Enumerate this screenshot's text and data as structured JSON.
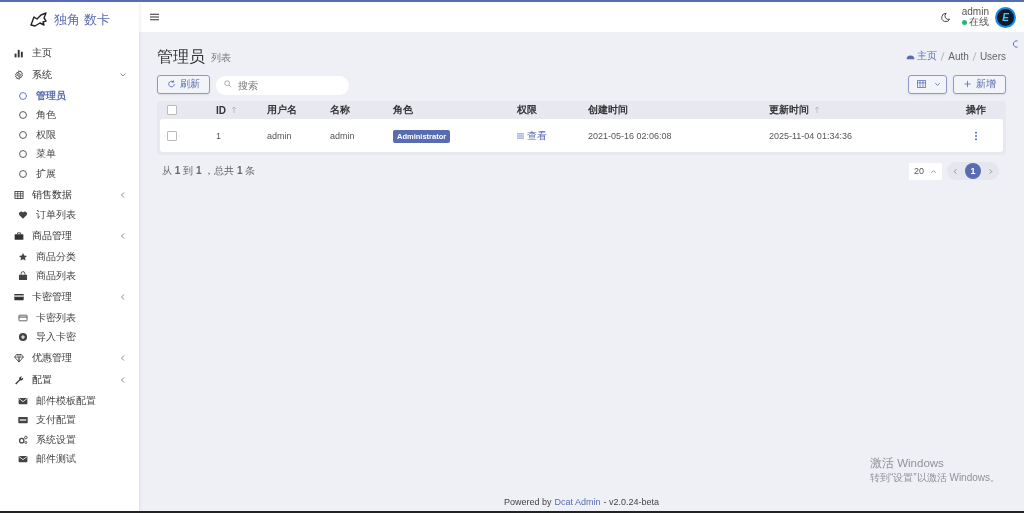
{
  "brand": {
    "name": "独角 数卡"
  },
  "sidebar": {
    "items": [
      {
        "label": "主页",
        "selected": false
      },
      {
        "label": "系统",
        "selected": false,
        "expanded": true,
        "children": [
          {
            "label": "管理员",
            "selected": true
          },
          {
            "label": "角色",
            "selected": false
          },
          {
            "label": "权限",
            "selected": false
          },
          {
            "label": "菜单",
            "selected": false
          },
          {
            "label": "扩展",
            "selected": false
          }
        ]
      },
      {
        "label": "销售数据",
        "selected": false,
        "expanded": false,
        "children": [
          {
            "label": "订单列表",
            "selected": false
          }
        ]
      },
      {
        "label": "商品管理",
        "selected": false,
        "expanded": false,
        "children": [
          {
            "label": "商品分类",
            "selected": false
          },
          {
            "label": "商品列表",
            "selected": false
          }
        ]
      },
      {
        "label": "卡密管理",
        "selected": false,
        "expanded": false,
        "children": [
          {
            "label": "卡密列表",
            "selected": false
          },
          {
            "label": "导入卡密",
            "selected": false
          }
        ]
      },
      {
        "label": "优惠管理",
        "selected": false,
        "expanded": false
      },
      {
        "label": "配置",
        "selected": false,
        "expanded": false,
        "children": [
          {
            "label": "邮件模板配置",
            "selected": false
          },
          {
            "label": "支付配置",
            "selected": false
          },
          {
            "label": "系统设置",
            "selected": false
          },
          {
            "label": "邮件测试",
            "selected": false
          }
        ]
      }
    ]
  },
  "user": {
    "name": "admin",
    "status": "在线",
    "online": true,
    "avatar_letter": "E"
  },
  "page": {
    "title": "管理员",
    "subtitle": "列表",
    "breadcrumb": [
      "主页",
      "Auth",
      "Users"
    ]
  },
  "toolbar": {
    "refresh": "刷新",
    "search": {
      "placeholder": "搜索"
    },
    "create": "新增"
  },
  "table": {
    "header_checked": false,
    "columns": [
      {
        "label": "ID",
        "sortable": true
      },
      {
        "label": "用户名",
        "sortable": false
      },
      {
        "label": "名称",
        "sortable": false
      },
      {
        "label": "角色",
        "sortable": false
      },
      {
        "label": "权限",
        "sortable": false
      },
      {
        "label": "创建时间",
        "sortable": false
      },
      {
        "label": "更新时间",
        "sortable": true
      },
      {
        "label": "操作",
        "sortable": false
      }
    ],
    "rows": [
      {
        "checked": false,
        "id": "1",
        "username": "admin",
        "name": "admin",
        "role": "Administrator",
        "permission": "查看",
        "created": "2021-05-16 02:06:08",
        "updated": "2025-11-04 01:34:36"
      }
    ]
  },
  "summary": "从 **1** 到 **1** ，总共 **1** 条",
  "pagination": {
    "per_page": "20",
    "pages": [
      {
        "label": "1",
        "selected": true
      }
    ]
  },
  "footer": {
    "prefix": "Powered by",
    "link": "Dcat Admin",
    "version": "- v2.0.24-beta"
  },
  "activation_notice": {
    "title": "激活 Windows",
    "text": "转到“设置”以激活 Windows。"
  }
}
